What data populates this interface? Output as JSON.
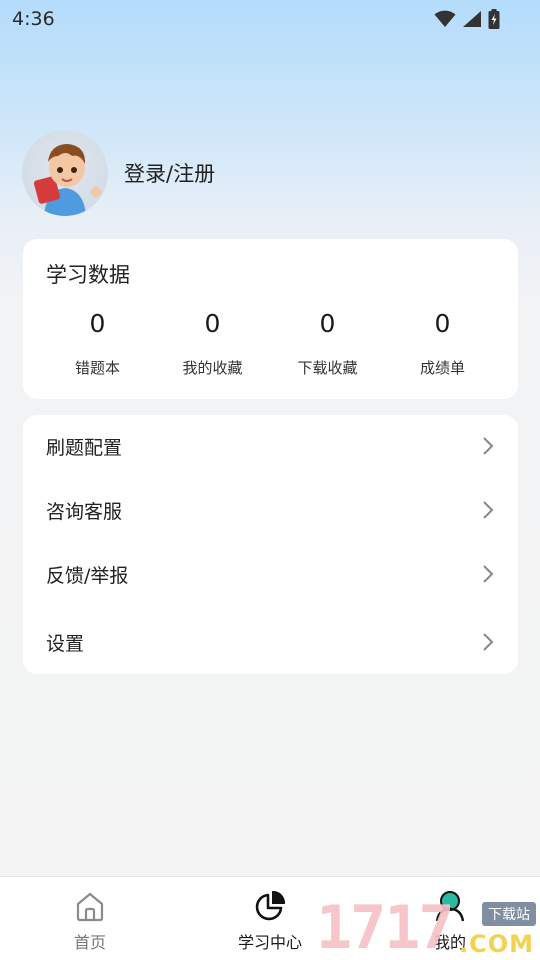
{
  "status_bar": {
    "time": "4:36"
  },
  "profile": {
    "login_label": "登录/注册"
  },
  "stats": {
    "title": "学习数据",
    "items": [
      {
        "value": "0",
        "label": "错题本"
      },
      {
        "value": "0",
        "label": "我的收藏"
      },
      {
        "value": "0",
        "label": "下载收藏"
      },
      {
        "value": "0",
        "label": "成绩单"
      }
    ]
  },
  "menu": {
    "items": [
      {
        "label": "刷题配置"
      },
      {
        "label": "咨询客服"
      },
      {
        "label": "反馈/举报"
      },
      {
        "label": "设置"
      }
    ]
  },
  "bottom_nav": {
    "items": [
      {
        "label": "首页",
        "icon": "home-icon",
        "active": false
      },
      {
        "label": "学习中心",
        "icon": "pie-chart-icon",
        "active": true
      },
      {
        "label": "我的",
        "icon": "profile-icon",
        "active": true
      }
    ]
  },
  "watermark": {
    "digits": "1717",
    "badge": "下载站",
    "suffix": ".COM"
  },
  "colors": {
    "accent_teal": "#2bb9a0",
    "header_gradient_top": "#b4dcfb",
    "background": "#f4f4f4"
  }
}
